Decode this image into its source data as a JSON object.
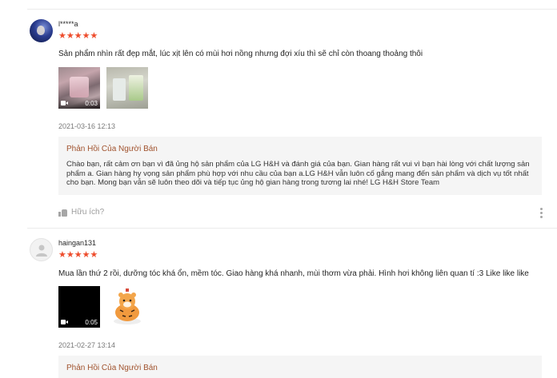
{
  "reviews": [
    {
      "username": "l*****a",
      "rating": 5,
      "stars": "★★★★★",
      "comment": "Sản phẩm nhìn rất đẹp mắt, lúc xịt lên có mùi hơi nồng nhưng đợi xíu thì sẽ chỉ còn thoang thoảng thôi",
      "video_duration": "0:03",
      "date": "2021-03-16 12:13",
      "reply_title": "Phản Hồi Của Người Bán",
      "reply_text": "Chào bạn, rất cảm ơn bạn vì đã ủng hộ sản phẩm của LG H&H và đánh giá của bạn. Gian hàng rất vui vì bạn hài lòng với chất lượng sản phẩm a. Gian hàng hy vọng sản phẩm phù hợp với nhu cầu của bạn a.LG H&H vẫn luôn cố gắng mang đến sản phẩm và dịch vụ tốt nhất cho bạn. Mong bạn vẫn sẽ luôn theo dõi và tiếp tục ủng hộ gian hàng trong tương lai nhé! LG H&H Store Team",
      "helpful_label": "Hữu ích?"
    },
    {
      "username": "haingan131",
      "rating": 5,
      "stars": "★★★★★",
      "comment": "Mua lần thứ 2 rồi, dưỡng tóc khá ổn, mềm tóc. Giao hàng khá nhanh, mùi thơm vừa phải. Hình hơi không liên quan tí :3 Like like like",
      "video_duration": "0:05",
      "date": "2021-02-27 13:14",
      "reply_title": "Phản Hồi Của Người Bán"
    }
  ],
  "colors": {
    "star": "#ee4d2d",
    "reply_title": "#a0522d",
    "reply_bg": "#f5f5f5"
  }
}
